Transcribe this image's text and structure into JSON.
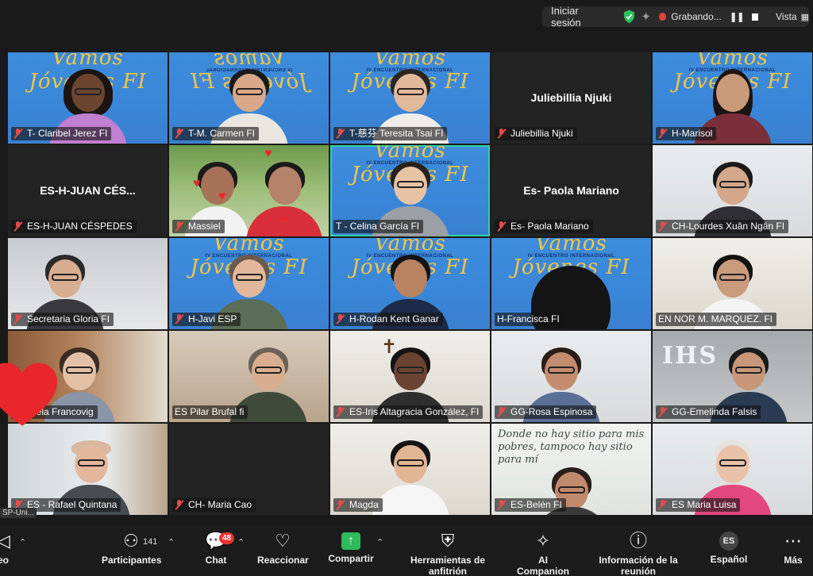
{
  "topbar": {
    "signin": "Iniciar sesión",
    "recording": "Grabando...",
    "view": "Vista",
    "colors": {
      "shield": "#2fbf5a",
      "record": "#e0443a"
    }
  },
  "tiles": [
    {
      "name": "T- Claribel Jerez FI",
      "muted": true
    },
    {
      "name": "T-M. Carmen FI",
      "muted": true
    },
    {
      "name": "T-慈芬 Teresita Tsai FI",
      "muted": true
    },
    {
      "name": "Juliebillia Njuki",
      "muted": true,
      "center_name": "Juliebillia Njuki"
    },
    {
      "name": "H-Marisol",
      "muted": true
    },
    {
      "name": "ES-H-JUAN CÉSPEDES",
      "muted": true,
      "center_name": "ES-H-JUAN  CÉS..."
    },
    {
      "name": "Massiel",
      "muted": true
    },
    {
      "name": "T - Celina García FI",
      "muted": false,
      "active": true
    },
    {
      "name": "Es- Paola Mariano",
      "muted": true,
      "center_name": "Es- Paola Mariano"
    },
    {
      "name": "CH-Lourdes Xuân Ngân FI",
      "muted": true
    },
    {
      "name": "Secretaria Gloria FI",
      "muted": true
    },
    {
      "name": "H-Javi ESP",
      "muted": true
    },
    {
      "name": "H-Rodan Kent Ganar",
      "muted": true
    },
    {
      "name": "H-Francisca FI",
      "muted": false
    },
    {
      "name": "EN NOR M. MARQUEZ. FI",
      "muted": false
    },
    {
      "name": "Graciela Francovig",
      "muted": false
    },
    {
      "name": "ES Pilar Brufal fi",
      "muted": false
    },
    {
      "name": "ES-Iris Altagracia González,  FI",
      "muted": true
    },
    {
      "name": "GG-Rosa Espinosa",
      "muted": true
    },
    {
      "name": "GG-Emelinda Falsis",
      "muted": true
    },
    {
      "name": "ES - Rafael Quintana",
      "muted": true
    },
    {
      "name": "CH- Maria Cao",
      "muted": true
    },
    {
      "name": "Magda",
      "muted": true
    },
    {
      "name": "ES-Belén FI",
      "muted": true
    },
    {
      "name": "ES  Maria Luisa",
      "muted": true
    }
  ],
  "banner": {
    "title": "Vamos Jóvenes FI",
    "subtitle": "IV ENCUENTRO INTERNACIONAL",
    "color": "#f5c542"
  },
  "decor": {
    "ihs": "IHS",
    "quote": "Donde no hay sitio para mis pobres, tampoco hay sitio para mí"
  },
  "overlay_tag": "SP-Uni...",
  "toolbar": {
    "participants_label": "Participantes",
    "participants_count": "141",
    "chat_label": "Chat",
    "chat_badge": "48",
    "react_label": "Reaccionar",
    "share_label": "Compartir",
    "host_tools_label": "Herramientas de anfitrión",
    "ai_label": "AI Companion",
    "info_label": "Información de la reunión",
    "lang_label": "Español",
    "lang_code": "ES",
    "more_label": "Más",
    "left_partial": "eo"
  }
}
